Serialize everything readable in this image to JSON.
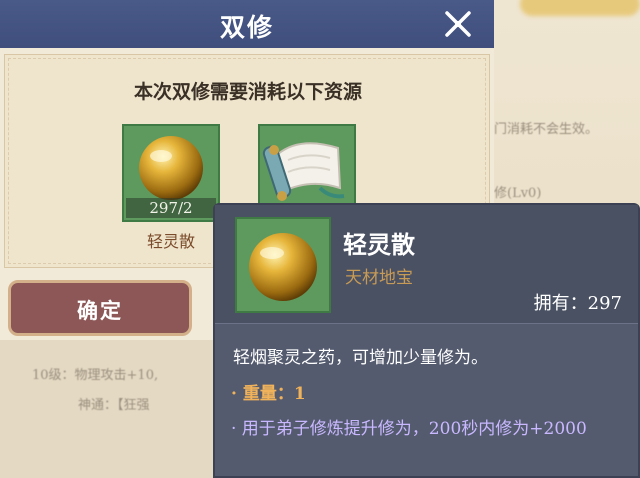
{
  "dialog": {
    "title": "双修",
    "consume_text": "本次双修需要消耗以下资源",
    "resources": [
      {
        "name": "轻灵散",
        "count": "297/2",
        "icon": "golden-pill-icon"
      },
      {
        "name": "",
        "count": "",
        "icon": "scroll-icon"
      }
    ],
    "confirm_label": "确定"
  },
  "tooltip": {
    "item_name": "轻灵散",
    "category": "天材地宝",
    "owned": "拥有：297",
    "description": "轻烟聚灵之药，可增加少量修为。",
    "weight": "· 重量：1",
    "effect": "· 用于弟子修炼提升修为，200秒内修为+2000"
  },
  "background": {
    "text_1": "门消耗不会生效。",
    "text_2": "修(Lv0)",
    "text_3": "10级：物理攻击+10,",
    "text_4": "神通：【狂强"
  },
  "colors": {
    "header_blue": "#4a5a88",
    "slot_green": "#5e9a5e",
    "confirm_red": "#8c5756",
    "tooltip_bg": "#545b6f",
    "category_gold": "#c79a55",
    "weight_orange": "#f0b25a",
    "effect_purple": "#c9b8ff"
  }
}
